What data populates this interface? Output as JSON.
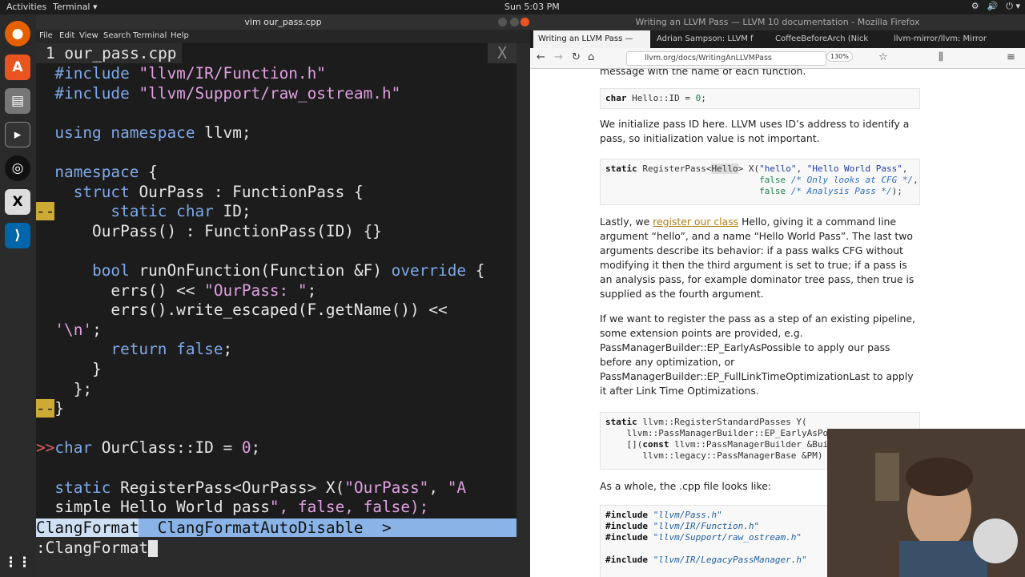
{
  "topbar": {
    "activities": "Activities",
    "app": "Terminal ▾",
    "clock": "Sun 5:03 PM",
    "tray": [
      "⚙",
      "🔊",
      "⏻ ▾"
    ]
  },
  "dock": {
    "items": [
      "firefox-icon",
      "store-icon",
      "files-icon",
      "terminal-icon",
      "obs-icon",
      "xterm-icon",
      "vscode-icon",
      "apps-grid-icon"
    ]
  },
  "terminal": {
    "title": "vim our_pass.cpp",
    "menu": [
      "File",
      "Edit",
      "View",
      "Search",
      "Terminal",
      "Help"
    ],
    "tab": {
      "number": "1",
      "name": "our_pass.cpp",
      "close": "X"
    },
    "wildmenu": "ClangFormat  ClangFormatAutoDisable  >",
    "command": ":ClangFormat"
  },
  "code": [
    {
      "t": "  #include \"llvm/IR/Function.h\""
    },
    {
      "t": "  #include \"llvm/Support/raw_ostream.h\""
    },
    {
      "t": ""
    },
    {
      "t": "  using namespace llvm;"
    },
    {
      "t": ""
    },
    {
      "t": "  namespace {"
    },
    {
      "t": "    struct OurPass : FunctionPass {"
    },
    {
      "t": "      static char ID;",
      "sign": "--"
    },
    {
      "t": "      OurPass() : FunctionPass(ID) {}"
    },
    {
      "t": ""
    },
    {
      "t": "      bool runOnFunction(Function &F) override {"
    },
    {
      "t": "        errs() << \"OurPass: \";"
    },
    {
      "t": "        errs().write_escaped(F.getName()) <<"
    },
    {
      "t": "  '\\n';"
    },
    {
      "t": "        return false;"
    },
    {
      "t": "      }"
    },
    {
      "t": "    };"
    },
    {
      "t": "}",
      "sign": "--"
    },
    {
      "t": ""
    },
    {
      "t": "char OurClass::ID = 0;",
      "sign": ">>"
    },
    {
      "t": ""
    },
    {
      "t": "  static RegisterPass<OurPass> X(\"OurPass\", \"A"
    },
    {
      "t": "  simple Hello World pass\", false, false);"
    }
  ],
  "firefox": {
    "title": "Writing an LLVM Pass — LLVM 10 documentation - Mozilla Firefox",
    "tabs": [
      "Writing an LLVM Pass —",
      "Adrian Sampson: LLVM f",
      "CoffeeBeforeArch (Nick",
      "llvm-mirror/llvm: Mirror"
    ],
    "url": "llvm.org/docs/WritingAnLLVMPass",
    "zoom": "130%",
    "frag_top": "message with the name of each function.",
    "code1": "char Hello::ID = 0;",
    "p1": "We initialize pass ID here. LLVM uses ID’s address to identify a pass, so initialization value is not important.",
    "code2": [
      "static RegisterPass<Hello> X(\"hello\", \"Hello World Pass\",",
      "                             false /* Only looks at CFG */,",
      "                             false /* Analysis Pass */);"
    ],
    "p2a": "Lastly, we ",
    "p2link": "register our class",
    "p2b": " Hello, giving it a command line argument “hello”, and a name “Hello World Pass”. The last two arguments describe its behavior: if a pass walks CFG without modifying it then the third argument is set to true; if a pass is an analysis pass, for example dominator tree pass, then true is supplied as the fourth argument.",
    "p3": "If we want to register the pass as a step of an existing pipeline, some extension points are provided, e.g. PassManagerBuilder::EP_EarlyAsPossible to apply our pass before any optimization, or PassManagerBuilder::EP_FullLinkTimeOptimizationLast to apply it after Link Time Optimizations.",
    "code3": [
      "static llvm::RegisterStandardPasses Y(",
      "    llvm::PassManagerBuilder::EP_EarlyAsPo",
      "    [](const llvm::PassManagerBuilder &Bui",
      "       llvm::legacy::PassManagerBase &PM)"
    ],
    "p4": "As a whole, the .cpp file looks like:",
    "code4": [
      "#include \"llvm/Pass.h\"",
      "#include \"llvm/IR/Function.h\"",
      "#include \"llvm/Support/raw_ostream.h\"",
      "",
      "#include \"llvm/IR/LegacyPassManager.h\""
    ]
  }
}
